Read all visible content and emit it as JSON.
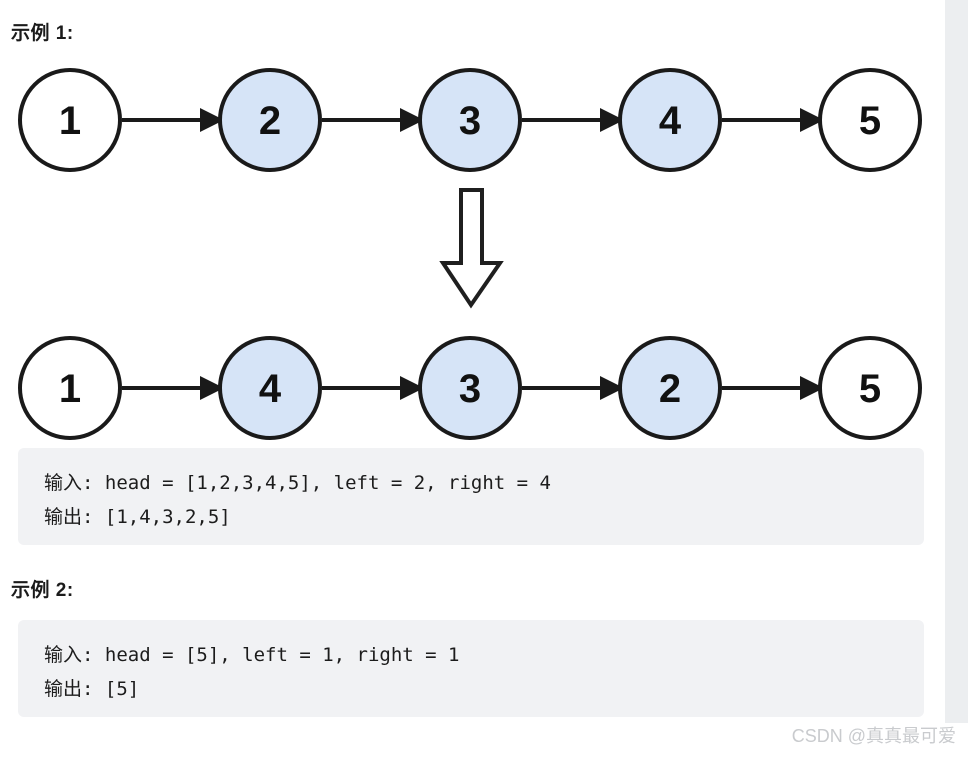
{
  "examples": [
    {
      "heading": "示例 1:",
      "lines": [
        "输入: head = [1,2,3,4,5], left = 2, right = 4",
        "输出: [1,4,3,2,5]"
      ]
    },
    {
      "heading": "示例 2:",
      "lines": [
        "输入: head = [5], left = 1, right = 1",
        "输出: [5]"
      ]
    }
  ],
  "diagram": {
    "transform_arrow": "down-arrow",
    "colors": {
      "node_highlight_fill": "#d6e4f7",
      "node_plain_fill": "#ffffff",
      "node_stroke": "#1a1a1a",
      "link_stroke": "#1a1a1a",
      "code_block_bg": "#f1f2f4",
      "gutter": "#eceef0",
      "watermark": "#c9cbce"
    },
    "rows": [
      {
        "name": "input-list",
        "nodes": [
          {
            "label": "1",
            "highlighted": false
          },
          {
            "label": "2",
            "highlighted": true
          },
          {
            "label": "3",
            "highlighted": true
          },
          {
            "label": "4",
            "highlighted": true
          },
          {
            "label": "5",
            "highlighted": false
          }
        ]
      },
      {
        "name": "output-list",
        "nodes": [
          {
            "label": "1",
            "highlighted": false
          },
          {
            "label": "4",
            "highlighted": true
          },
          {
            "label": "3",
            "highlighted": true
          },
          {
            "label": "2",
            "highlighted": true
          },
          {
            "label": "5",
            "highlighted": false
          }
        ]
      }
    ]
  },
  "watermark": "CSDN @真真最可爱"
}
